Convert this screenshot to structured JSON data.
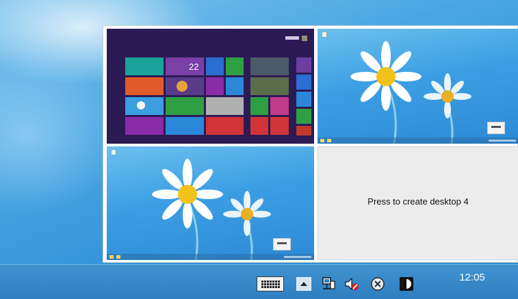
{
  "switcher": {
    "desktops": [
      {
        "id": 1,
        "kind": "start-screen"
      },
      {
        "id": 2,
        "kind": "wallpaper"
      },
      {
        "id": 3,
        "kind": "wallpaper"
      }
    ],
    "create_label": "Press to create desktop 4"
  },
  "start_screen": {
    "tile_colors": [
      "#1aa39a",
      "#7a3fa8",
      "#2b6ed1",
      "#2ea043",
      "#e05a2a",
      "#2b5fb8",
      "#d13438",
      "#2b88d8",
      "#d6a11a",
      "#c0392b",
      "#6a3fa0"
    ]
  },
  "taskbar": {
    "clock": "12:05",
    "tray_icons": [
      "keyboard-icon",
      "chevron-up-icon",
      "network-icon",
      "volume-muted-icon",
      "close-circle-icon",
      "app-icon"
    ]
  },
  "colors": {
    "taskbar": "#2f7fc0",
    "start_background": "#2c1a55",
    "create_pane": "#ececec"
  }
}
